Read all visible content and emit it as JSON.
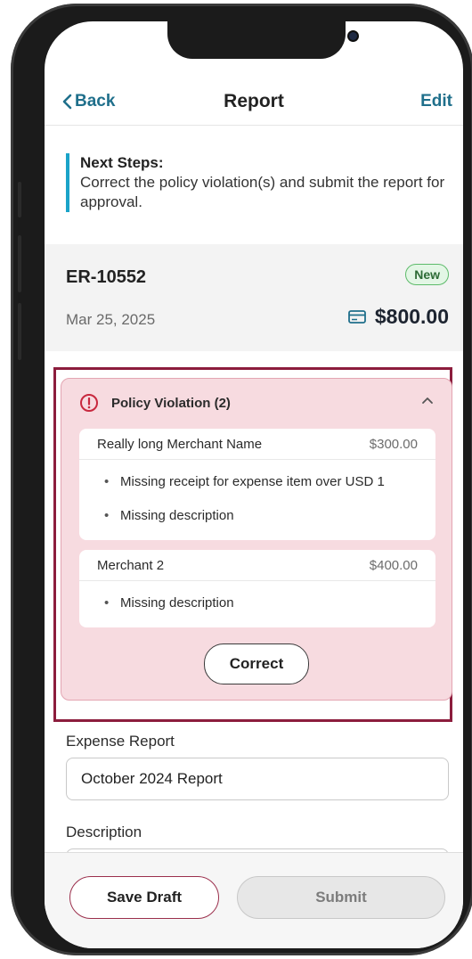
{
  "nav": {
    "back_label": "Back",
    "title": "Report",
    "edit_label": "Edit"
  },
  "next_steps": {
    "title": "Next Steps:",
    "body": "Correct the policy violation(s) and submit the report for approval."
  },
  "report": {
    "id": "ER-10552",
    "status_badge": "New",
    "date": "Mar 25, 2025",
    "amount": "$800.00",
    "amount_icon": "credit-card-icon"
  },
  "policy_violation": {
    "title": "Policy Violation (2)",
    "icon": "alert-circle-icon",
    "expanded": true,
    "items": [
      {
        "merchant": "Really long Merchant Name",
        "amount": "$300.00",
        "issues": [
          "Missing receipt for expense item over USD 1",
          "Missing description"
        ]
      },
      {
        "merchant": "Merchant 2",
        "amount": "$400.00",
        "issues": [
          "Missing description"
        ]
      }
    ],
    "action_label": "Correct"
  },
  "form": {
    "expense_report_label": "Expense Report",
    "expense_report_value": "October 2024 Report",
    "description_label": "Description"
  },
  "footer": {
    "save_draft_label": "Save Draft",
    "submit_label": "Submit"
  },
  "colors": {
    "link": "#1f6f8b",
    "accent_bar": "#1aa3c8",
    "violation_bg": "#f7dbe0",
    "violation_outline": "#8c1d3d",
    "badge_bg": "#e3f6e5",
    "badge_border": "#5dbb6a"
  }
}
